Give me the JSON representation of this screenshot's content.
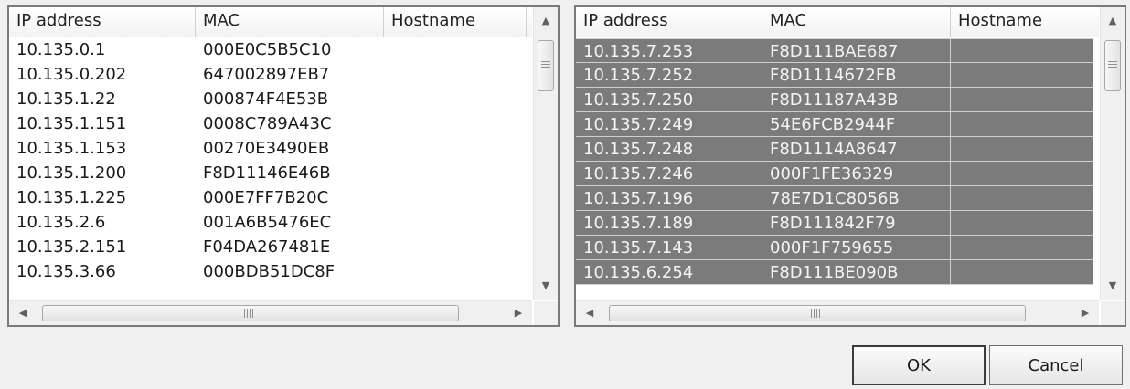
{
  "columns": [
    "IP address",
    "MAC",
    "Hostname"
  ],
  "left_list": {
    "rows": [
      {
        "ip": "10.135.0.1",
        "mac": "000E0C5B5C10",
        "hostname": ""
      },
      {
        "ip": "10.135.0.202",
        "mac": "647002897EB7",
        "hostname": ""
      },
      {
        "ip": "10.135.1.22",
        "mac": "000874F4E53B",
        "hostname": ""
      },
      {
        "ip": "10.135.1.151",
        "mac": "0008C789A43C",
        "hostname": ""
      },
      {
        "ip": "10.135.1.153",
        "mac": "00270E3490EB",
        "hostname": ""
      },
      {
        "ip": "10.135.1.200",
        "mac": "F8D11146E46B",
        "hostname": ""
      },
      {
        "ip": "10.135.1.225",
        "mac": "000E7FF7B20C",
        "hostname": ""
      },
      {
        "ip": "10.135.2.6",
        "mac": "001A6B5476EC",
        "hostname": ""
      },
      {
        "ip": "10.135.2.151",
        "mac": "F04DA267481E",
        "hostname": ""
      },
      {
        "ip": "10.135.3.66",
        "mac": "000BDB51DC8F",
        "hostname": ""
      }
    ]
  },
  "right_list": {
    "rows": [
      {
        "ip": "10.135.7.253",
        "mac": "F8D111BAE687",
        "hostname": ""
      },
      {
        "ip": "10.135.7.252",
        "mac": "F8D1114672FB",
        "hostname": ""
      },
      {
        "ip": "10.135.7.250",
        "mac": "F8D11187A43B",
        "hostname": ""
      },
      {
        "ip": "10.135.7.249",
        "mac": "54E6FCB2944F",
        "hostname": ""
      },
      {
        "ip": "10.135.7.248",
        "mac": "F8D1114A8647",
        "hostname": ""
      },
      {
        "ip": "10.135.7.246",
        "mac": "000F1FE36329",
        "hostname": ""
      },
      {
        "ip": "10.135.7.196",
        "mac": "78E7D1C8056B",
        "hostname": ""
      },
      {
        "ip": "10.135.7.189",
        "mac": "F8D111842F79",
        "hostname": ""
      },
      {
        "ip": "10.135.7.143",
        "mac": "000F1F759655",
        "hostname": ""
      },
      {
        "ip": "10.135.6.254",
        "mac": "F8D111BE090B",
        "hostname": ""
      }
    ]
  },
  "icons": {
    "scroll_up": "▲",
    "scroll_down": "▼",
    "scroll_left": "◀",
    "scroll_right": "▶"
  },
  "colors": {
    "selection_bg": "#7b7b7b",
    "selection_text": "#f4f4f4"
  },
  "buttons": {
    "ok": "OK",
    "cancel": "Cancel"
  }
}
